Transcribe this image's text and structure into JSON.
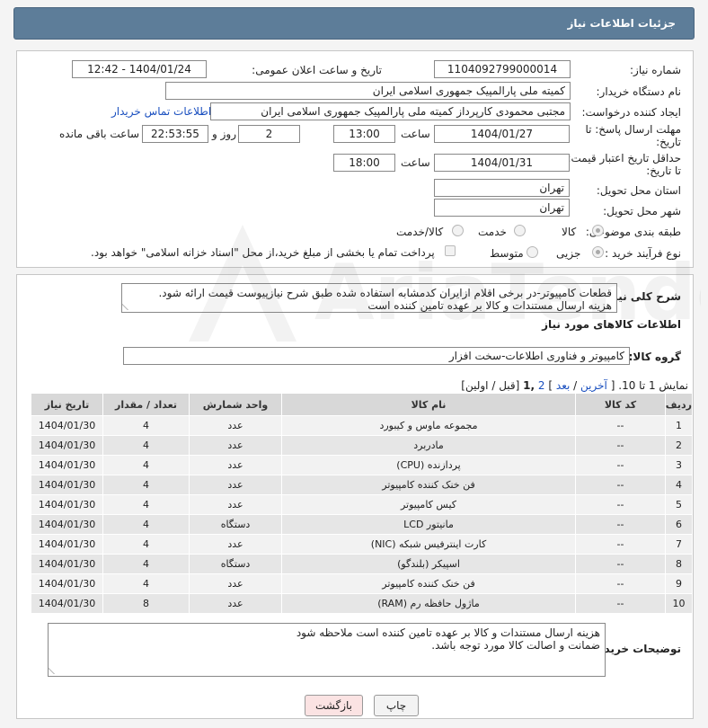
{
  "header": {
    "title": "جزئیات اطلاعات نیاز"
  },
  "form": {
    "need_number_label": "شماره نیاز:",
    "need_number": "1104092799000014",
    "announce_label": "تاریخ و ساعت اعلان عمومی:",
    "announce_value": "1404/01/24 - 12:42",
    "buyer_org_label": "نام دستگاه خریدار:",
    "buyer_org": "کمیته ملی پارالمپیک جمهوری اسلامی ایران",
    "requester_label": "ایجاد کننده درخواست:",
    "requester": "مجتبی محمودی کارپرداز کمیته ملی پارالمپیک جمهوری اسلامی ایران",
    "buyer_contact_link": "اطلاعات تماس خریدار",
    "deadline_label_1": "مهلت ارسال پاسخ: تا",
    "deadline_label_2": "تاریخ:",
    "deadline_date": "1404/01/27",
    "time_word": "ساعت",
    "deadline_time": "13:00",
    "days_value": "2",
    "days_word": "روز و",
    "remaining_time": "22:53:55",
    "remaining_word": "ساعت باقی مانده",
    "validity_label_1": "حداقل تاریخ اعتبار قیمت:",
    "validity_label_2": "تا تاریخ:",
    "validity_date": "1404/01/31",
    "validity_time": "18:00",
    "delivery_province_label": "استان محل تحویل:",
    "delivery_province": "تهران",
    "delivery_city_label": "شهر محل تحویل:",
    "delivery_city": "تهران",
    "category_label": "طبقه بندی موضوعی:",
    "category_options": [
      "کالا",
      "خدمت",
      "کالا/خدمت"
    ],
    "category_selected": "کالا",
    "process_label": "نوع فرآیند خرید :",
    "process_options": [
      "جزیی",
      "متوسط"
    ],
    "process_selected": "جزیی",
    "treasury_note": "پرداخت تمام یا بخشی از مبلغ خرید،از محل \"اسناد خزانه اسلامی\" خواهد بود."
  },
  "description": {
    "label": "شرح کلی نیاز:",
    "lines": [
      "قطعات کامپیوتر-در برخی اقلام ازایران کدمشابه استفاده شده طبق شرح نیازپیوست قیمت ارائه شود.",
      "هزینه ارسال مستندات و کالا بر عهده تامین کننده است"
    ]
  },
  "goods": {
    "section_title": "اطلاعات کالاهای مورد نیاز",
    "group_label": "گروه کالا:",
    "group_value": "کامپیوتر و فناوری اطلاعات-سخت افزار",
    "paging_text": "نمایش 1 تا 10.",
    "paging_links": [
      "[",
      "آخرین",
      "/",
      "بعد",
      "]",
      "2",
      ",1",
      "[قبل / اولین]"
    ],
    "columns": [
      "ردیف",
      "کد کالا",
      "نام کالا",
      "واحد شمارش",
      "تعداد / مقدار",
      "تاریخ نیاز"
    ],
    "rows": [
      [
        "1",
        "--",
        "مجموعه ماوس و کیبورد",
        "عدد",
        "4",
        "1404/01/30"
      ],
      [
        "2",
        "--",
        "مادربرد",
        "عدد",
        "4",
        "1404/01/30"
      ],
      [
        "3",
        "--",
        "پردازنده (CPU)",
        "عدد",
        "4",
        "1404/01/30"
      ],
      [
        "4",
        "--",
        "فن خنک کننده کامپیوتر",
        "عدد",
        "4",
        "1404/01/30"
      ],
      [
        "5",
        "--",
        "کیس کامپیوتر",
        "عدد",
        "4",
        "1404/01/30"
      ],
      [
        "6",
        "--",
        "مانیتور LCD",
        "دستگاه",
        "4",
        "1404/01/30"
      ],
      [
        "7",
        "--",
        "کارت اینترفیس شبکه (NIC)",
        "عدد",
        "4",
        "1404/01/30"
      ],
      [
        "8",
        "--",
        "اسپیکر (بلندگو)",
        "دستگاه",
        "4",
        "1404/01/30"
      ],
      [
        "9",
        "--",
        "فن خنک کننده کامپیوتر",
        "عدد",
        "4",
        "1404/01/30"
      ],
      [
        "10",
        "--",
        "ماژول حافظه رم (RAM)",
        "عدد",
        "8",
        "1404/01/30"
      ]
    ]
  },
  "buyer_notes": {
    "label": "توضیحات خریدار:",
    "lines": [
      "هزینه ارسال مستندات و کالا بر عهده تامین کننده است ملاحظه شود",
      "ضمانت و اصالت کالا مورد توجه باشد."
    ]
  },
  "actions": {
    "print": "چاپ",
    "back": "بازگشت"
  },
  "watermark": {
    "text": "AriaTender.neT"
  },
  "colors": {
    "header": "#5d7d99",
    "link": "#1a4fbf",
    "back_button": "#fbe3e3"
  }
}
